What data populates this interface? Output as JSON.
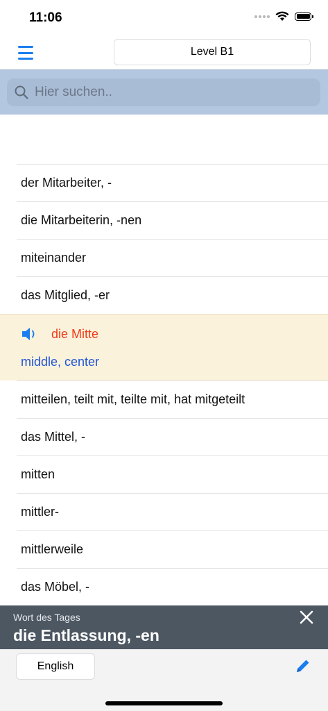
{
  "status": {
    "time": "11:06"
  },
  "nav": {
    "level_label": "Level B1"
  },
  "search": {
    "placeholder": "Hier suchen.."
  },
  "list": {
    "items": [
      "der Mitarbeiter, -",
      "die Mitarbeiterin, -nen",
      "miteinander",
      "das Mitglied, -er"
    ],
    "expanded": {
      "word": "die Mitte",
      "translation": "middle, center"
    },
    "items_after": [
      "mitteilen, teilt mit, teilte mit, hat mitgeteilt",
      "das Mittel, -",
      "mitten",
      "mittler-",
      "mittlerweile",
      "das Möbel, -"
    ]
  },
  "word_of_day": {
    "label": "Wort des Tages",
    "word": "die Entlassung, -en"
  },
  "bottom": {
    "language_label": "English"
  },
  "colors": {
    "accent": "#1a7ef0",
    "search_band": "#b4c7e1",
    "highlight_bg": "#fbf2dc",
    "highlight_word": "#f03a17",
    "translation": "#1f54d6",
    "wotd_bg": "#4c5762"
  },
  "icons": [
    "menu-icon",
    "search-icon",
    "speaker-icon",
    "close-icon",
    "edit-icon",
    "wifi-icon",
    "battery-icon"
  ]
}
